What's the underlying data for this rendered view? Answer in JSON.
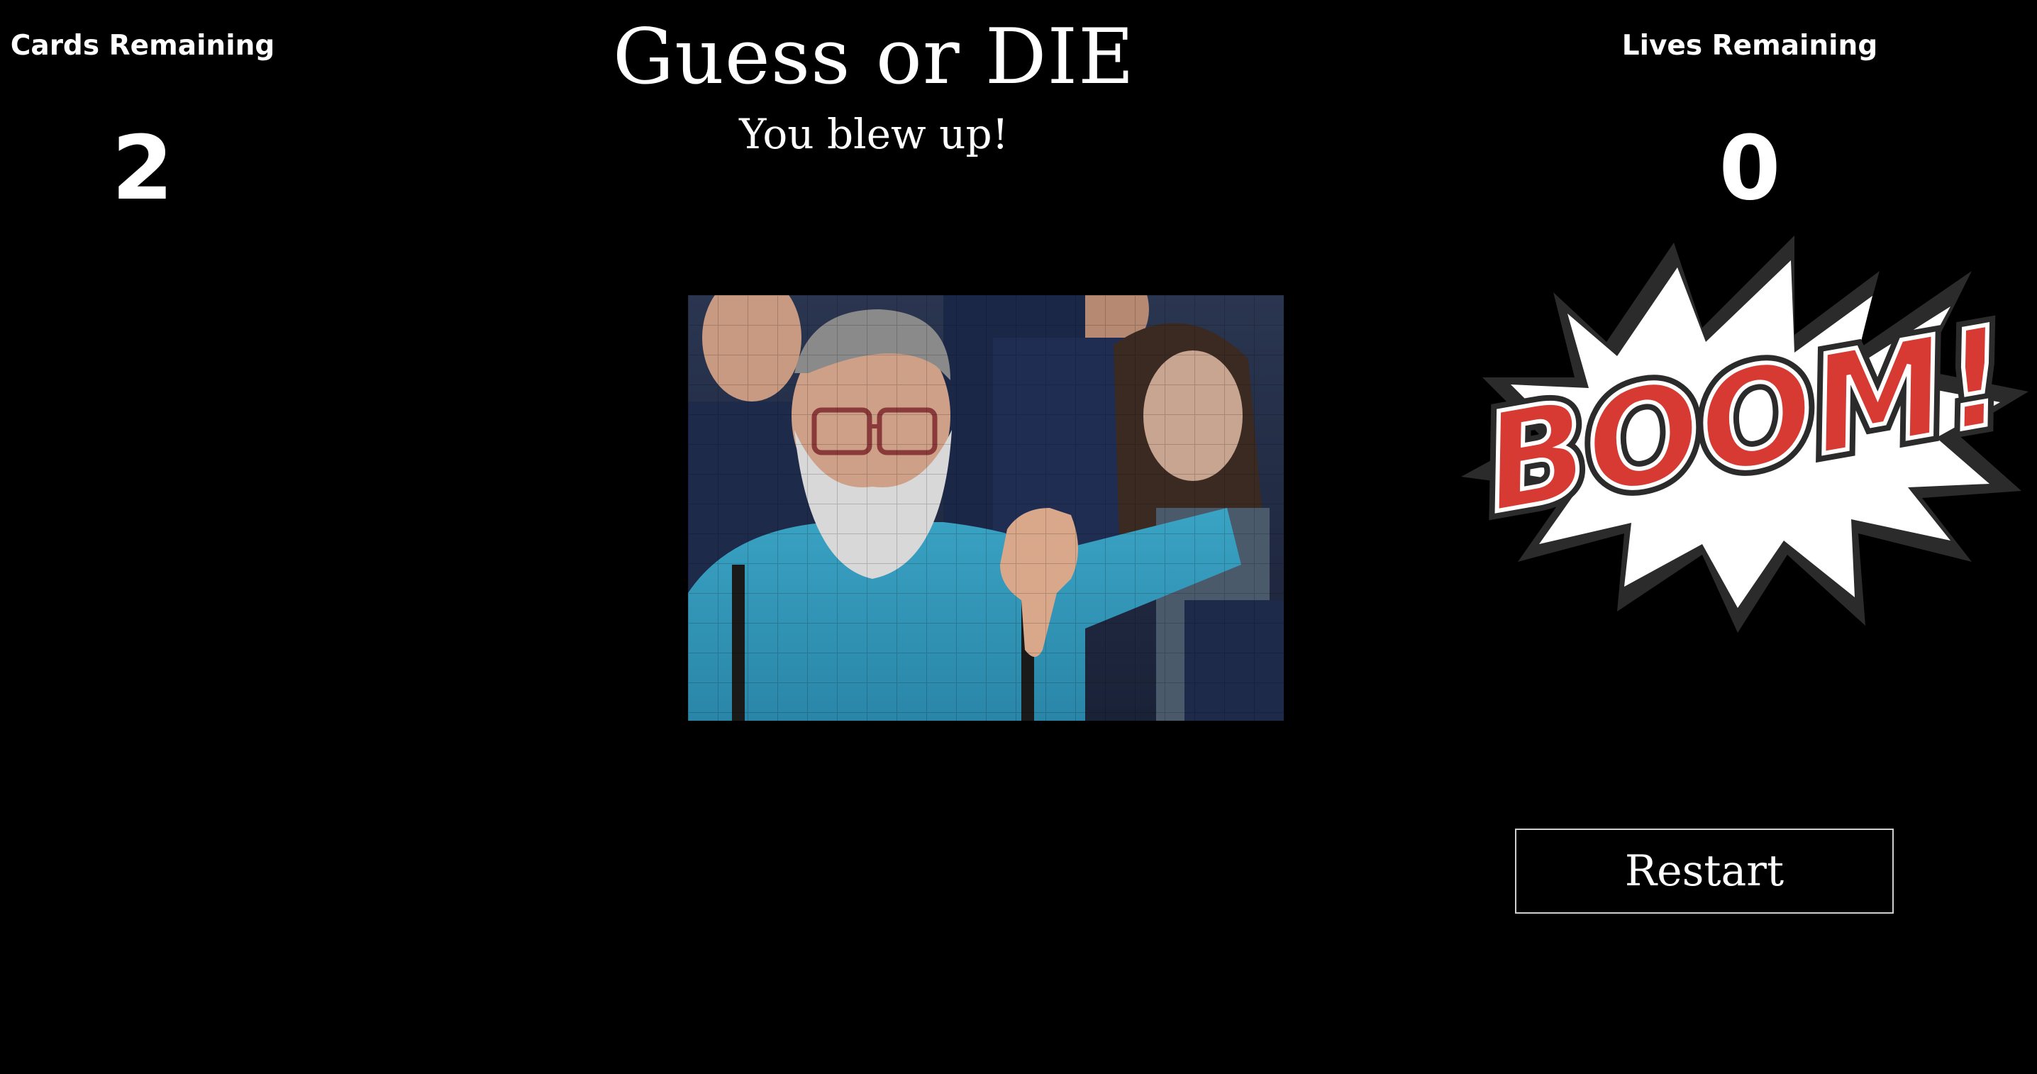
{
  "header": {
    "title": "Guess or DIE",
    "subtitle": "You blew up!"
  },
  "cards": {
    "label": "Cards Remaining",
    "value": "2"
  },
  "lives": {
    "label": "Lives Remaining",
    "value": "0"
  },
  "explosion": {
    "text": "BOOM!",
    "text_color": "#d63a32",
    "burst_color": "#ffffff",
    "outline_color": "#2b2b2b"
  },
  "restart": {
    "label": "Restart"
  },
  "photo": {
    "icon": "thumbs-down-fan-photo"
  },
  "colors": {
    "background": "#000000",
    "text": "#ffffff",
    "button_border": "#cfcfcf"
  }
}
